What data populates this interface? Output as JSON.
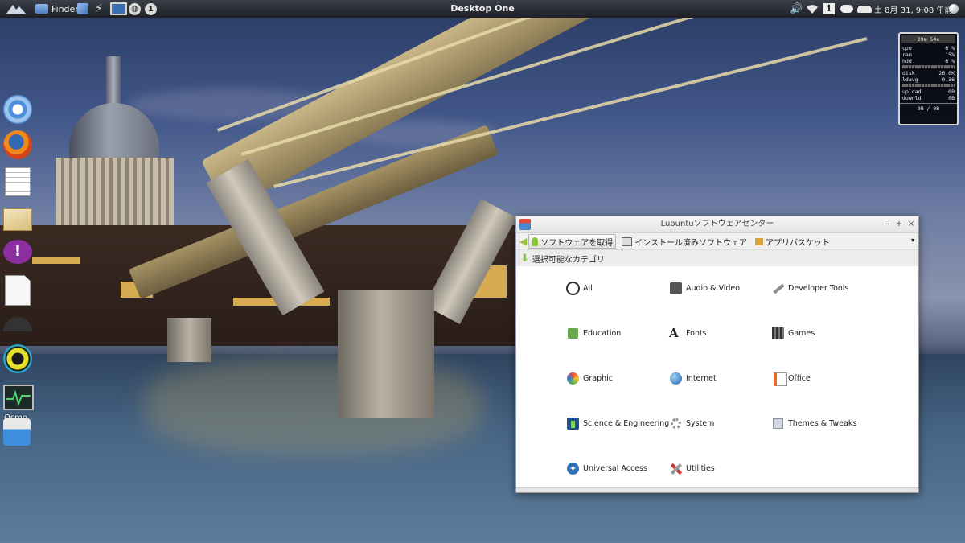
{
  "topbar": {
    "finder_label": "Finder",
    "title": "Desktop One",
    "clock": "土  8月 31,  9:08 午前",
    "workspace_number": "1"
  },
  "conky": {
    "uptime": "29m 54s",
    "cpu_label": "cpu",
    "cpu_value": "6 %",
    "ram_label": "ram",
    "ram_value": "15%",
    "hdd_label": "hdd",
    "hdd_value": "6 %",
    "disk_label": "disk",
    "disk_value": "26.0K",
    "ldavg_label": "ldavg",
    "ldavg_value": "0.36",
    "upload_label": "upload",
    "upload_value": "0B",
    "downld_label": "downld",
    "downld_value": "0B",
    "total": "0B   /  0B"
  },
  "dock": {
    "items": [
      "chromium-icon",
      "firefox-icon",
      "text-editor-icon",
      "mail-icon",
      "empathy-icon",
      "libreoffice-icon",
      "osmo-icon",
      "deadbeef-icon",
      "system-monitor-icon",
      "calendar-icon"
    ],
    "osmo_label": "Osmo"
  },
  "window": {
    "title": "Lubuntuソフトウェアセンター",
    "tabs": [
      {
        "label": "ソフトウェアを取得"
      },
      {
        "label": "インストール済みソフトウェア"
      },
      {
        "label": "アプリバスケット"
      }
    ],
    "breadcrumb": "選択可能なカテゴリ",
    "categories": [
      {
        "label": "All"
      },
      {
        "label": "Audio & Video"
      },
      {
        "label": "Developer Tools"
      },
      {
        "label": "Education"
      },
      {
        "label": "Fonts"
      },
      {
        "label": "Games"
      },
      {
        "label": "Graphic"
      },
      {
        "label": "Internet"
      },
      {
        "label": "Office"
      },
      {
        "label": "Science & Engineering"
      },
      {
        "label": "System"
      },
      {
        "label": "Themes & Tweaks"
      },
      {
        "label": "Universal Access"
      },
      {
        "label": "Utilities"
      }
    ]
  }
}
